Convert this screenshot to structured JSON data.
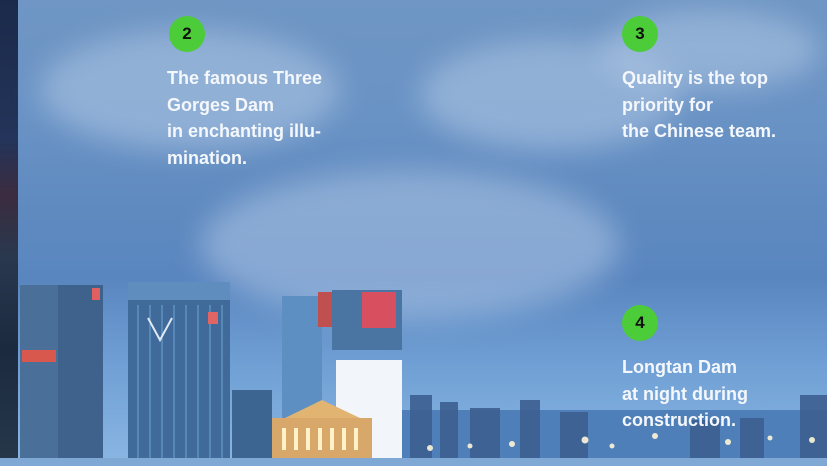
{
  "markers": [
    {
      "number": "2",
      "caption": "The famous Three\nGorges Dam\nin enchanting illu-\nmination."
    },
    {
      "number": "3",
      "caption": "Quality is the top\npriority for\nthe Chinese team."
    },
    {
      "number": "4",
      "caption": "Longtan Dam\nat night during\nconstruction."
    }
  ],
  "colors": {
    "badge": "#4ccc38",
    "caption_text": "#f4f7fb",
    "sky": "#6a93c5"
  }
}
